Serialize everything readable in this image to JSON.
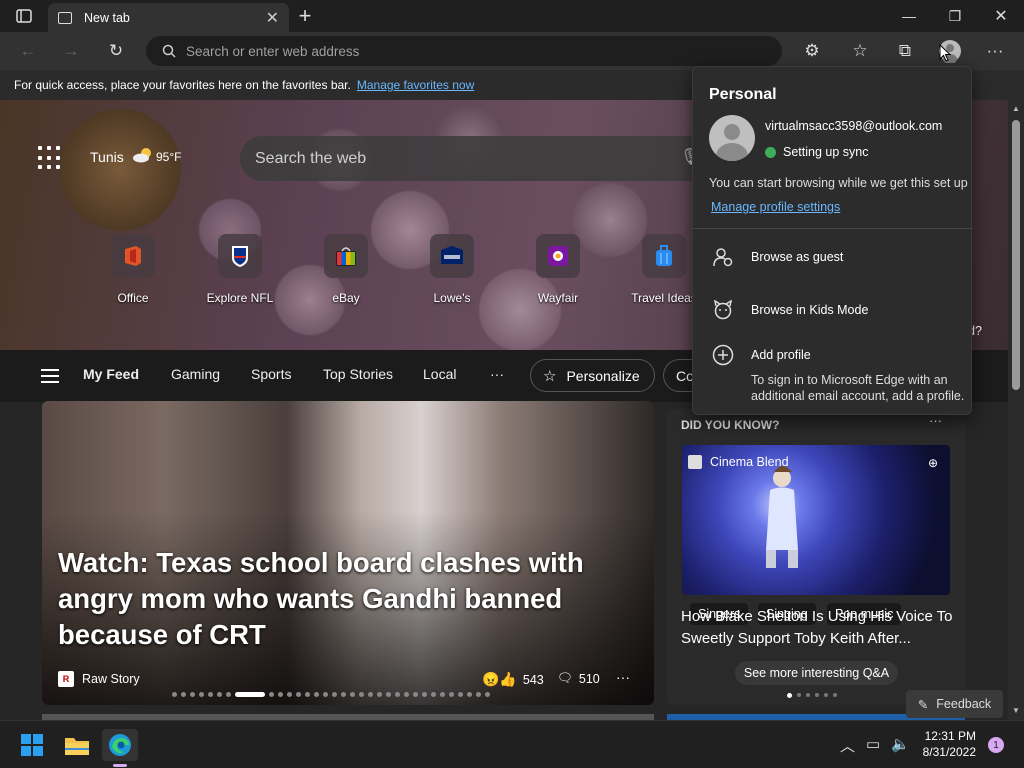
{
  "browser": {
    "tab_title": "New tab",
    "address_placeholder": "Search or enter web address",
    "favorites_bar_text": "For quick access, place your favorites here on the favorites bar.",
    "favorites_bar_link": "Manage favorites now"
  },
  "ntp": {
    "city": "Tunis",
    "temperature": "95",
    "temp_unit": "°F",
    "search_placeholder": "Search the web",
    "quick_links": [
      {
        "label": "Office",
        "icon": "office-icon"
      },
      {
        "label": "Explore NFL",
        "icon": "nfl-icon"
      },
      {
        "label": "eBay",
        "icon": "ebay-icon"
      },
      {
        "label": "Lowe's",
        "icon": "lowes-icon"
      },
      {
        "label": "Wayfair",
        "icon": "wayfair-icon"
      },
      {
        "label": "Travel Ideas",
        "icon": "travel-icon"
      }
    ],
    "hero_partial_text": "d?",
    "feed_tabs": [
      "My Feed",
      "Gaming",
      "Sports",
      "Top Stories",
      "Local"
    ],
    "more_tabs": "···",
    "personalize_label": "Personalize",
    "partial_tab": "Co",
    "headline": "Watch: Texas school board clashes with angry mom who wants Gandhi banned because of CRT",
    "source": "Raw Story",
    "source_logo": "R",
    "reactions": "543",
    "comments": "510",
    "did_you_know": "DID YOU KNOW?",
    "dyk_source": "Cinema Blend",
    "dyk_tags": [
      "Singers",
      "Singing",
      "Pop music"
    ],
    "dyk_title": "How Blake Shelton Is Using His Voice To Sweetly Support Toby Keith After...",
    "see_more": "See more interesting Q&A",
    "feedback": "Feedback"
  },
  "profile_popup": {
    "heading": "Personal",
    "email": "virtualmsacc3598@outlook.com",
    "sync_status": "Setting up sync",
    "note": "You can start browsing while we get this set up",
    "manage_link": "Manage profile settings",
    "guest": "Browse as guest",
    "kids": "Browse in Kids Mode",
    "add_profile": "Add profile",
    "add_profile_note": "To sign in to Microsoft Edge with an additional email account, add a profile."
  },
  "taskbar": {
    "time": "12:31 PM",
    "date": "8/31/2022",
    "notifications": "1"
  },
  "colors": {
    "accent_link": "#6ab7ff",
    "sync_ok": "#3fae5a"
  }
}
